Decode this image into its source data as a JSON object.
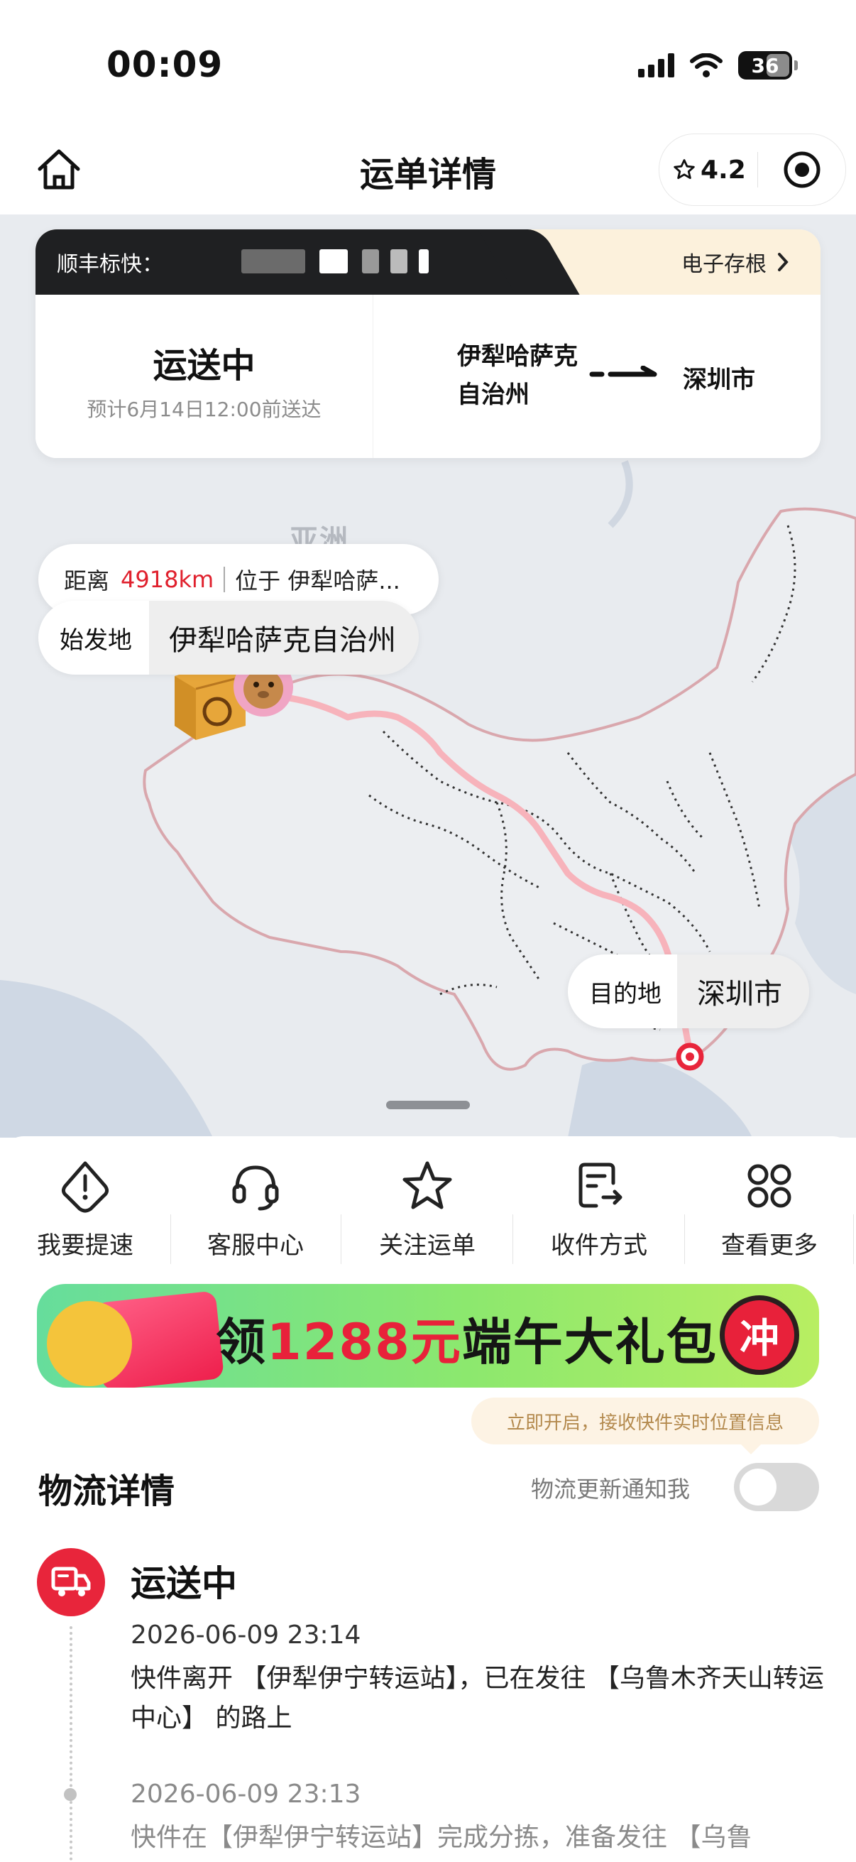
{
  "status_bar": {
    "time": "00:09",
    "battery": "36"
  },
  "nav": {
    "title": "运单详情",
    "rating": "4.2"
  },
  "card": {
    "tracking_label": "顺丰标快：",
    "archive_link": "电子存根",
    "status": "运送中",
    "eta": "预计6月14日12:00前送达",
    "origin": "伊犁哈萨克自治州",
    "destination": "深圳市"
  },
  "map": {
    "continent_label": "亚洲",
    "distance_label": "距离",
    "distance_value": "4918km",
    "location_text": "位于 伊犁哈萨...",
    "origin_label": "始发地",
    "origin_value": "伊犁哈萨克自治州",
    "dest_label": "目的地",
    "dest_value": "深圳市",
    "route_color": "#f7b3bb",
    "dest_marker_color": "#e8253b"
  },
  "actions": [
    {
      "label": "我要提速",
      "icon": "alert-bubble-icon"
    },
    {
      "label": "客服中心",
      "icon": "headset-icon"
    },
    {
      "label": "关注运单",
      "icon": "star-icon"
    },
    {
      "label": "收件方式",
      "icon": "delivery-method-icon"
    },
    {
      "label": "查看更多",
      "icon": "grid-more-icon"
    }
  ],
  "banner": {
    "prefix": "领",
    "amount": "1288元",
    "suffix": "端午大礼包",
    "cta": "冲"
  },
  "tooltip": "立即开启，接收快件实时位置信息",
  "logistics": {
    "title": "物流详情",
    "notify_label": "物流更新通知我",
    "notify_enabled": false,
    "current_status": "运送中",
    "events": [
      {
        "time": "2026-06-09 23:14",
        "desc": "快件离开 【伊犁伊宁转运站】，已在发往 【乌鲁木齐天山转运中心】 的路上"
      },
      {
        "time": "2026-06-09 23:13",
        "desc": "快件在【伊犁伊宁转运站】完成分拣，准备发往 【乌鲁"
      }
    ]
  },
  "colors": {
    "accent_red": "#e8253b",
    "highlight_red": "#e0202d",
    "banner_green": "#8ce86e"
  }
}
